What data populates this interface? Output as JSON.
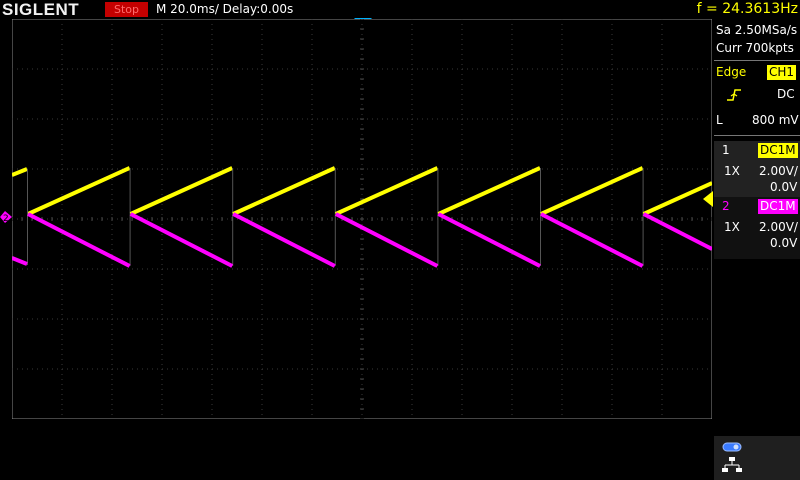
{
  "header": {
    "brand": "SIGLENT",
    "run_state": "Stop",
    "timebase": "M 20.0ms/ Delay:0.00s",
    "frequency": "f = 24.3613Hz"
  },
  "acquisition": {
    "sample_rate": "Sa 2.50MSa/s",
    "memory_depth": "Curr 700kpts"
  },
  "trigger": {
    "type_label": "Edge",
    "source": "CH1",
    "coupling": "DC",
    "level_label": "L",
    "level_value": "800 mV"
  },
  "channels": [
    {
      "number": "1",
      "coupling": "DC1M",
      "probe": "1X",
      "scale": "2.00V/",
      "offset": "0.0V",
      "color": "#ffff00"
    },
    {
      "number": "2",
      "coupling": "DC1M",
      "probe": "1X",
      "scale": "2.00V/",
      "offset": "0.0V",
      "color": "#ff00ff"
    }
  ],
  "colors": {
    "ch1": "#ffff00",
    "ch2": "#ff00ff",
    "trigger_marker": "#00b4ff",
    "stop": "#c40000"
  },
  "icons": [
    "trigger-position-marker-icon",
    "ch1-reference-marker-icon",
    "ch2-reference-marker-icon",
    "trigger-level-marker-icon",
    "edge-rising-icon",
    "usb-icon",
    "network-icon"
  ]
}
